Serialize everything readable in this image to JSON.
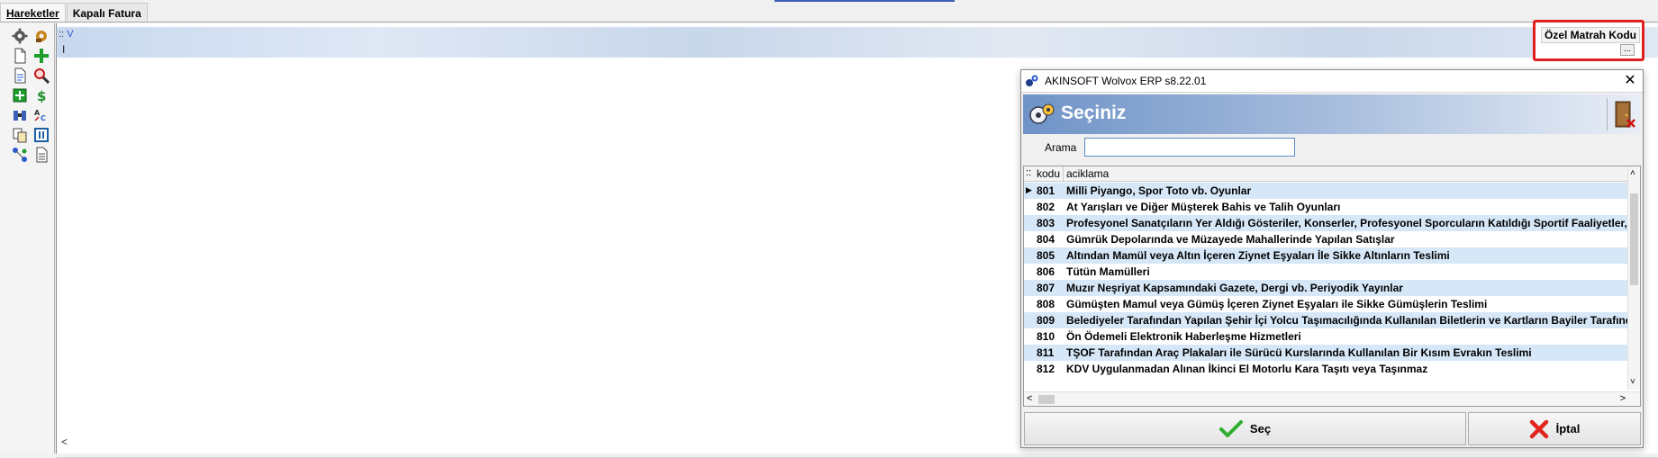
{
  "tabs": [
    "Hareketler",
    "Kapalı Fatura"
  ],
  "grid": {
    "dots": "::",
    "header_fragment": "V",
    "row_cursor": "I",
    "hscroll_left": "<"
  },
  "column_popup": {
    "header": "Özel Matrah Kodu",
    "ellipsis": "..."
  },
  "dialog": {
    "title": "AKINSOFT Wolvox ERP s8.22.01",
    "close": "✕",
    "banner_title": "Seçiniz",
    "search_label": "Arama",
    "search_value": "",
    "list": {
      "dots": "::",
      "headers": [
        "kodu",
        "aciklama"
      ],
      "rows": [
        {
          "kod": "801",
          "aciklama": "Milli Piyango, Spor Toto vb. Oyunlar",
          "current": true
        },
        {
          "kod": "802",
          "aciklama": "At Yarışları ve Diğer Müşterek Bahis ve Talih Oyunları"
        },
        {
          "kod": "803",
          "aciklama": "Profesyonel Sanatçıların Yer Aldığı Gösteriler, Konserler, Profesyonel Sporcuların Katıldığı Sportif Faaliyetler, M"
        },
        {
          "kod": "804",
          "aciklama": "Gümrük Depolarında ve Müzayede Mahallerinde Yapılan Satışlar"
        },
        {
          "kod": "805",
          "aciklama": "Altından Mamül veya Altın İçeren Ziynet Eşyaları İle Sikke Altınların Teslimi"
        },
        {
          "kod": "806",
          "aciklama": "Tütün Mamülleri"
        },
        {
          "kod": "807",
          "aciklama": "Muzır Neşriyat Kapsamındaki Gazete, Dergi vb. Periyodik Yayınlar"
        },
        {
          "kod": "808",
          "aciklama": "Gümüşten Mamul veya Gümüş İçeren Ziynet Eşyaları ile Sikke Gümüşlerin Teslimi"
        },
        {
          "kod": "809",
          "aciklama": "Belediyeler Tarafından Yapılan Şehir İçi Yolcu Taşımacılığında Kullanılan Biletlerin ve Kartların Bayiler Tarafınd"
        },
        {
          "kod": "810",
          "aciklama": "Ön Ödemeli Elektronik Haberleşme Hizmetleri"
        },
        {
          "kod": "811",
          "aciklama": "TŞOF Tarafından Araç Plakaları ile Sürücü Kurslarında Kullanılan Bir Kısım Evrakın Teslimi"
        },
        {
          "kod": "812",
          "aciklama": "KDV Uygulanmadan Alınan İkinci El Motorlu Kara Taşıtı veya Taşınmaz"
        }
      ]
    },
    "buttons": {
      "select": "Seç",
      "cancel": "İptal"
    }
  },
  "colors": {
    "highlight": "#e02020",
    "row_alt": "#d6e7f8",
    "banner": "#6f93c7"
  }
}
